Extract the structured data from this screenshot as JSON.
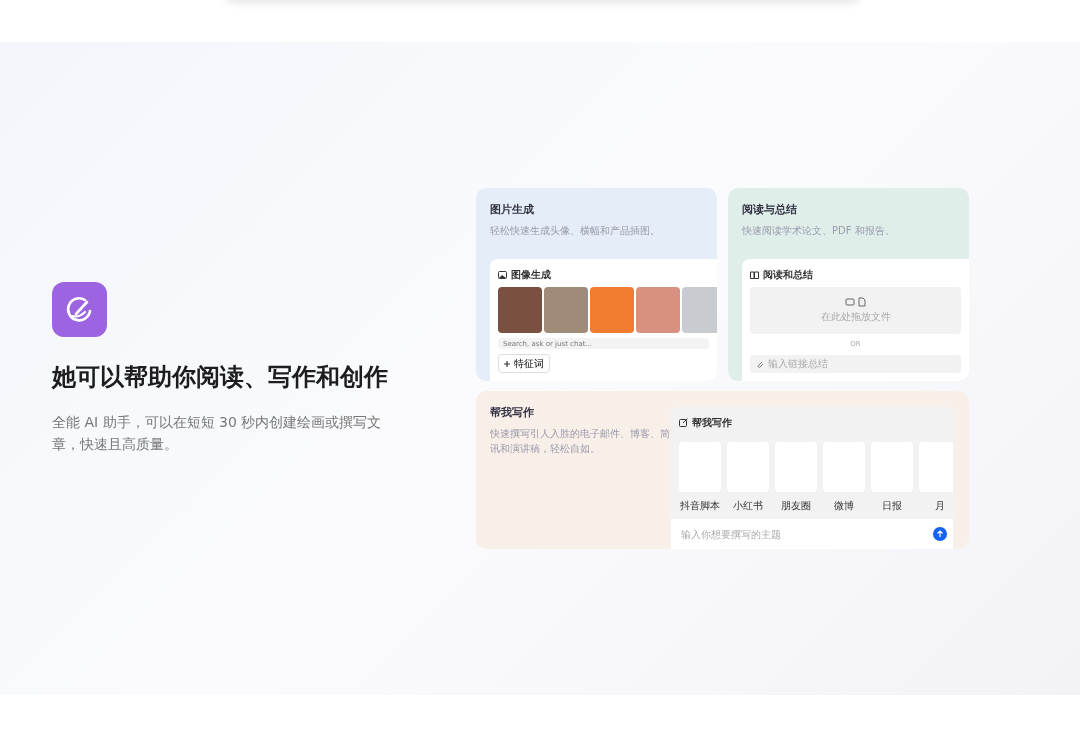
{
  "hero": {
    "title": "她可以帮助你阅读、写作和创作",
    "description": "全能 AI 助手，可以在短短 30 秒内创建绘画或撰写文章，快速且高质量。"
  },
  "features": [
    {
      "kind": "image",
      "title": "图片生成",
      "subtitle": "轻松快速生成头像、横幅和产品插图。",
      "panel_title": "图像生成",
      "search_placeholder": "Search, ask or just chat...",
      "button": "特征词"
    },
    {
      "kind": "reading",
      "title": "阅读与总结",
      "subtitle": "快速阅读学术论文、PDF 和报告。",
      "panel_title": "阅读和总结",
      "drop_text": "在此处拖放文件",
      "divider": "OR",
      "link_placeholder": "输入链接总结"
    },
    {
      "kind": "writing",
      "title": "帮我写作",
      "subtitle": "快速撰写引人入胜的电子邮件、博客、简讯和演讲稿，轻松自如。",
      "panel_title": "帮我写作",
      "templates": [
        "抖音脚本",
        "小红书",
        "朋友圈",
        "微博",
        "日报",
        "月"
      ],
      "placeholder": "输入你想要撰写的主题"
    }
  ]
}
